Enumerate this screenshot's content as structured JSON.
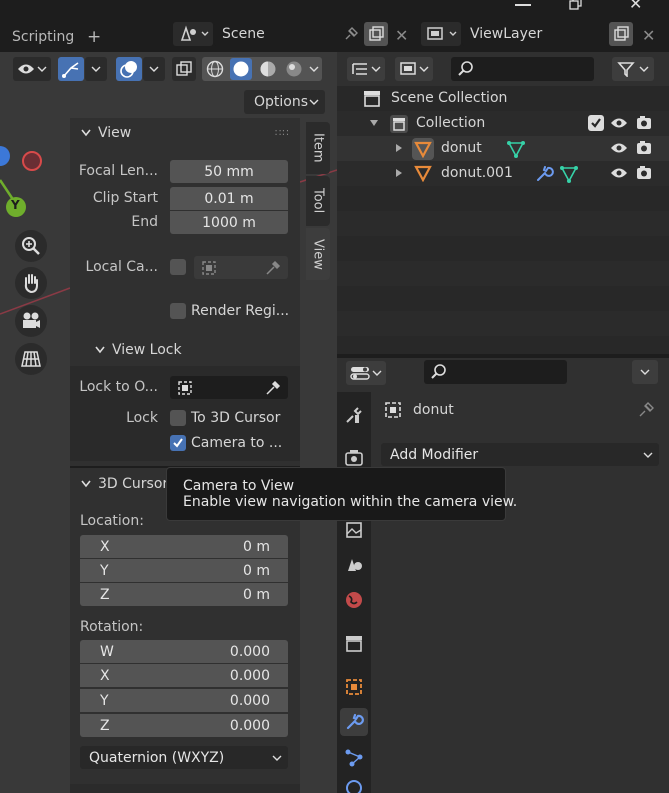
{
  "topbar": {
    "workspace_tab": "Scripting",
    "add_tab": "+",
    "scene_name": "Scene",
    "view_layer_name": "ViewLayer"
  },
  "viewport": {
    "options_label": "Options",
    "axis_y": "Y"
  },
  "npanel": {
    "tabs": [
      "Item",
      "Tool",
      "View"
    ],
    "active_tab": "View",
    "view": {
      "title": "View",
      "focal_length_label": "Focal Len...",
      "focal_length_value": "50 mm",
      "clip_start_label": "Clip Start",
      "clip_start_value": "0.01 m",
      "clip_end_label": "End",
      "clip_end_value": "1000 m",
      "local_camera_label": "Local Ca...",
      "render_region_label": "Render Regi..."
    },
    "view_lock": {
      "title": "View Lock",
      "lock_to_object_label": "Lock to O...",
      "lock_label": "Lock",
      "to_3d_cursor_label": "To 3D Cursor",
      "to_3d_cursor_checked": false,
      "camera_to_view_label": "Camera to ...",
      "camera_to_view_checked": true
    },
    "cursor": {
      "title": "3D Cursor",
      "location_label": "Location:",
      "location": [
        {
          "axis": "X",
          "value": "0 m"
        },
        {
          "axis": "Y",
          "value": "0 m"
        },
        {
          "axis": "Z",
          "value": "0 m"
        }
      ],
      "rotation_label": "Rotation:",
      "rotation": [
        {
          "axis": "W",
          "value": "0.000"
        },
        {
          "axis": "X",
          "value": "0.000"
        },
        {
          "axis": "Y",
          "value": "0.000"
        },
        {
          "axis": "Z",
          "value": "0.000"
        }
      ],
      "rotation_mode": "Quaternion (WXYZ)"
    }
  },
  "outliner": {
    "scene_collection": "Scene Collection",
    "collection": "Collection",
    "objects": [
      {
        "name": "donut",
        "selected": true
      },
      {
        "name": "donut.001",
        "selected": false
      }
    ]
  },
  "properties": {
    "object_name": "donut",
    "add_modifier_label": "Add Modifier"
  },
  "tooltip": {
    "title": "Camera to View",
    "description": "Enable view navigation within the camera view."
  },
  "colors": {
    "accent": "#4772b3",
    "object_orange": "#e88a3a",
    "mesh_teal": "#36d2a8",
    "modifier_blue": "#6c9bf0",
    "axis_red": "#d84a4a",
    "axis_green": "#6fae2c",
    "axis_blue": "#3c78d8"
  }
}
